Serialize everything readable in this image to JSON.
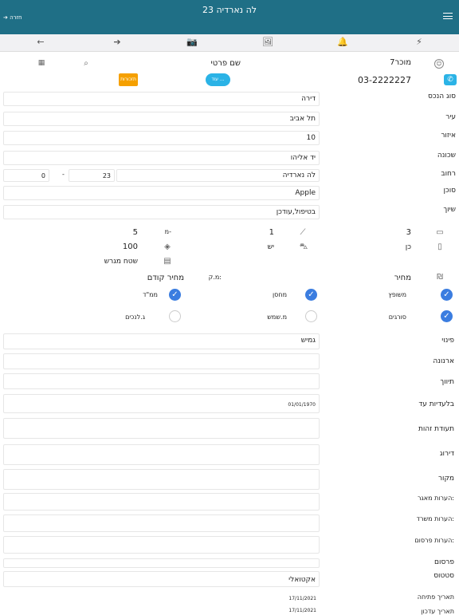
{
  "header": {
    "title": "לה נארדיה 23",
    "back": "➔ חזרה"
  },
  "toolbar": [
    "⚡",
    "🔔",
    "🖼",
    "📷",
    "➔",
    "←"
  ],
  "top": {
    "seller": "מוכר7",
    "phone": "03-2222227",
    "private_name": "שם פרטי",
    "button_edit": "עוד ...",
    "button_reminders": "תזכורות"
  },
  "fields": [
    {
      "label": "סוג הנכס",
      "value": "דירה"
    },
    {
      "label": "עיר",
      "value": "תל אביב"
    },
    {
      "label": "איזור",
      "value": "10"
    },
    {
      "label": "שכונה",
      "value": "יד אליהו"
    }
  ],
  "street": {
    "label": "רחוב",
    "name": "לה נארדיה",
    "number": "23",
    "dash": "-",
    "entrance": "0"
  },
  "agent": {
    "label": "סוכן",
    "value": "Apple"
  },
  "assignment": {
    "label": "שיוך",
    "value": "בטיפול,עודכן"
  },
  "specs": {
    "rooms": "3",
    "floors": "1",
    "floor_range_label": "מ-",
    "floor_range_value": "5",
    "yes_no_label": "כן",
    "exists_label": "יש",
    "size": "100",
    "plot_area_label": "שטח מגרש"
  },
  "price": {
    "label": "מחיר",
    "sqm_label": "מ.ק:",
    "prev_label": "מחיר קודם"
  },
  "options": [
    {
      "label": "משופץ",
      "checked": true
    },
    {
      "label": "מחסן",
      "checked": true
    },
    {
      "label": "ממ\"ד",
      "checked": true
    },
    {
      "label": "סורגים",
      "checked": true
    },
    {
      "label": "מ.שמש",
      "checked": false
    },
    {
      "label": "ג.לנכים",
      "checked": false
    }
  ],
  "lower": [
    {
      "label": "פינוי",
      "value": "גמיש"
    },
    {
      "label": "ארנונה",
      "value": ""
    },
    {
      "label": "תיווך",
      "value": ""
    },
    {
      "label": "בלעדיות עד",
      "value": "01/01/1970"
    },
    {
      "label": "תעודת זהות",
      "value": ""
    },
    {
      "label": "דירוג",
      "value": ""
    },
    {
      "label": "מקור",
      "value": ""
    },
    {
      "label": "הערות מאגר:",
      "value": ""
    },
    {
      "label": "הערות משרד:",
      "value": ""
    },
    {
      "label": "הערות פרסום:",
      "value": ""
    },
    {
      "label": "פרסום",
      "value": ""
    },
    {
      "label": "סטטוס",
      "value": "אקטואלי"
    },
    {
      "label": "תאריך פתיחה",
      "value": "17/11/2021"
    },
    {
      "label": "תאריך עדכון",
      "value": "17/11/2021"
    }
  ]
}
